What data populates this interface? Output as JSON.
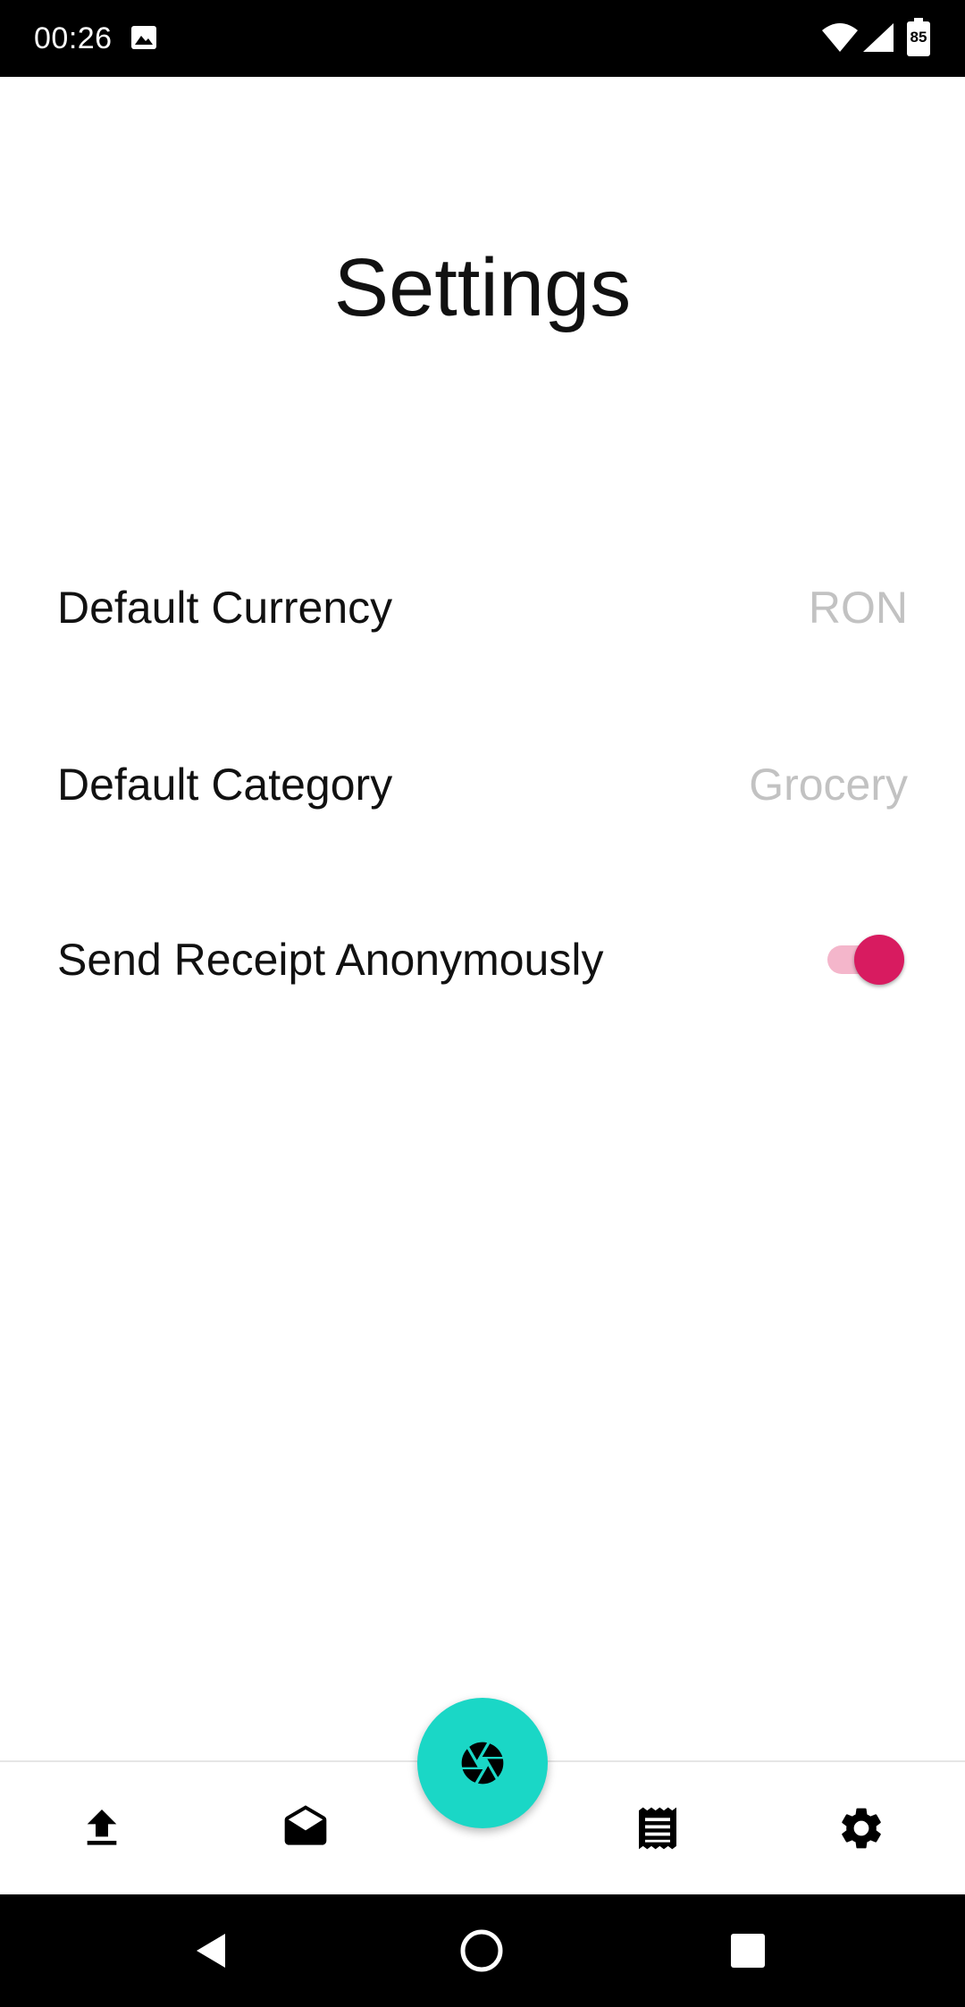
{
  "status_bar": {
    "time": "00:26",
    "battery_level": "85",
    "icons": [
      "image-icon",
      "wifi-icon",
      "signal-icon",
      "battery-icon"
    ]
  },
  "page": {
    "title": "Settings"
  },
  "settings": {
    "default_currency": {
      "label": "Default Currency",
      "value": "RON"
    },
    "default_category": {
      "label": "Default Category",
      "value": "Grocery"
    },
    "send_anonymously": {
      "label": "Send Receipt Anonymously",
      "enabled": true
    }
  },
  "bottom_nav": {
    "items": [
      {
        "icon": "upload-icon"
      },
      {
        "icon": "inbox-icon"
      },
      {
        "icon": "receipt-icon"
      },
      {
        "icon": "gear-icon"
      }
    ],
    "fab_icon": "camera-shutter-icon"
  },
  "system_nav": {
    "buttons": [
      "back-icon",
      "home-icon",
      "recents-icon"
    ]
  },
  "colors": {
    "accent": "#d81b60",
    "fab": "#1ad7c6",
    "muted_value": "#c2c2c2"
  }
}
